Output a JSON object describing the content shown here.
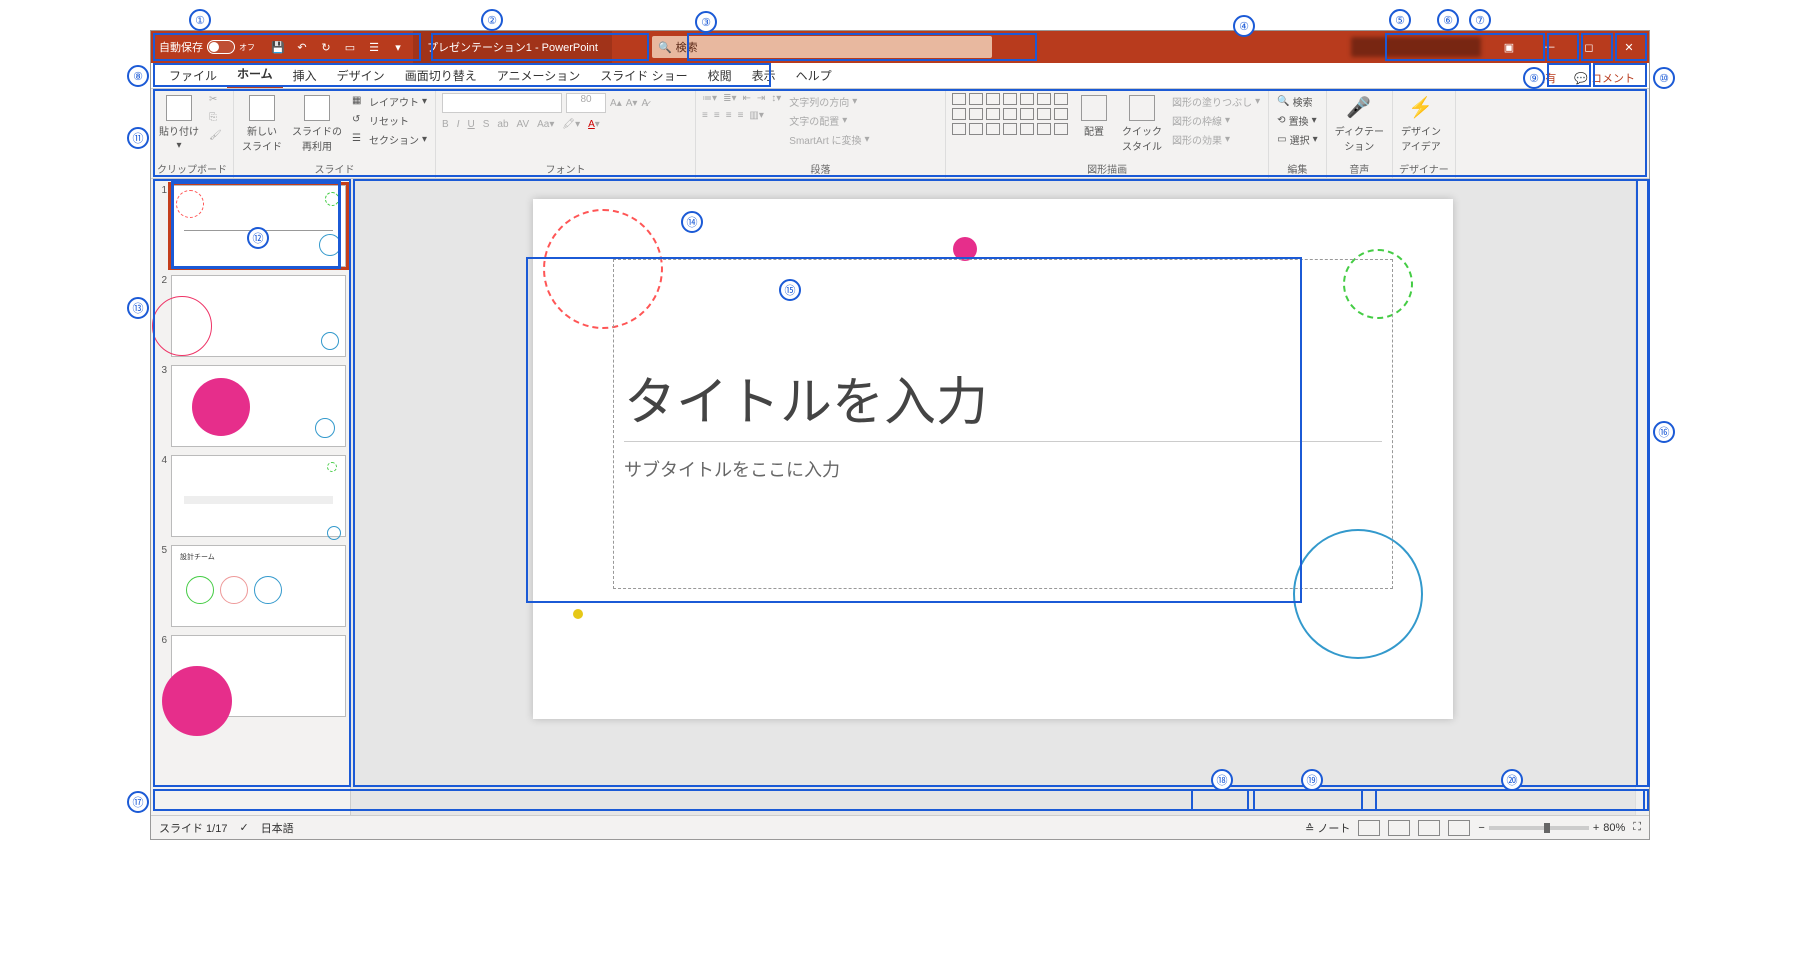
{
  "titlebar": {
    "autosave_label": "自動保存",
    "autosave_state": "オフ",
    "doc_title": "プレゼンテーション1 - PowerPoint",
    "search_placeholder": "検索"
  },
  "tabs": {
    "items": [
      "ファイル",
      "ホーム",
      "挿入",
      "デザイン",
      "画面切り替え",
      "アニメーション",
      "スライド ショー",
      "校閲",
      "表示",
      "ヘルプ"
    ],
    "active_index": 1,
    "share": "共有",
    "comments": "コメント"
  },
  "ribbon": {
    "clipboard": {
      "label": "クリップボード",
      "paste": "貼り付け"
    },
    "slides": {
      "label": "スライド",
      "new": "新しい\nスライド",
      "reuse": "スライドの\n再利用",
      "layout": "レイアウト",
      "reset": "リセット",
      "section": "セクション"
    },
    "font": {
      "label": "フォント",
      "size": "80"
    },
    "paragraph": {
      "label": "段落",
      "direction": "文字列の方向",
      "align": "文字の配置",
      "smartart": "SmartArt に変換"
    },
    "drawing": {
      "label": "図形描画",
      "arrange": "配置",
      "quickstyle": "クイック\nスタイル",
      "fill": "図形の塗りつぶし",
      "outline": "図形の枠線",
      "effects": "図形の効果"
    },
    "editing": {
      "label": "編集",
      "find": "検索",
      "replace": "置換",
      "select": "選択"
    },
    "voice": {
      "label": "音声",
      "dictate": "ディクテー\nション"
    },
    "designer": {
      "label": "デザイナー",
      "ideas": "デザイン\nアイデア"
    }
  },
  "canvas": {
    "title_placeholder": "タイトルを入力",
    "subtitle_placeholder": "サブタイトルをここに入力"
  },
  "thumbs": {
    "count": 6,
    "selected": 1,
    "slide5_text": "設計チーム"
  },
  "status": {
    "slide_counter": "スライド 1/17",
    "language": "日本語",
    "notes": "ノート",
    "zoom": "80%"
  },
  "callouts": [
    "①",
    "②",
    "③",
    "④",
    "⑤",
    "⑥",
    "⑦",
    "⑧",
    "⑨",
    "⑩",
    "⑪",
    "⑫",
    "⑬",
    "⑭",
    "⑮",
    "⑯",
    "⑰",
    "⑱",
    "⑲",
    "⑳"
  ]
}
